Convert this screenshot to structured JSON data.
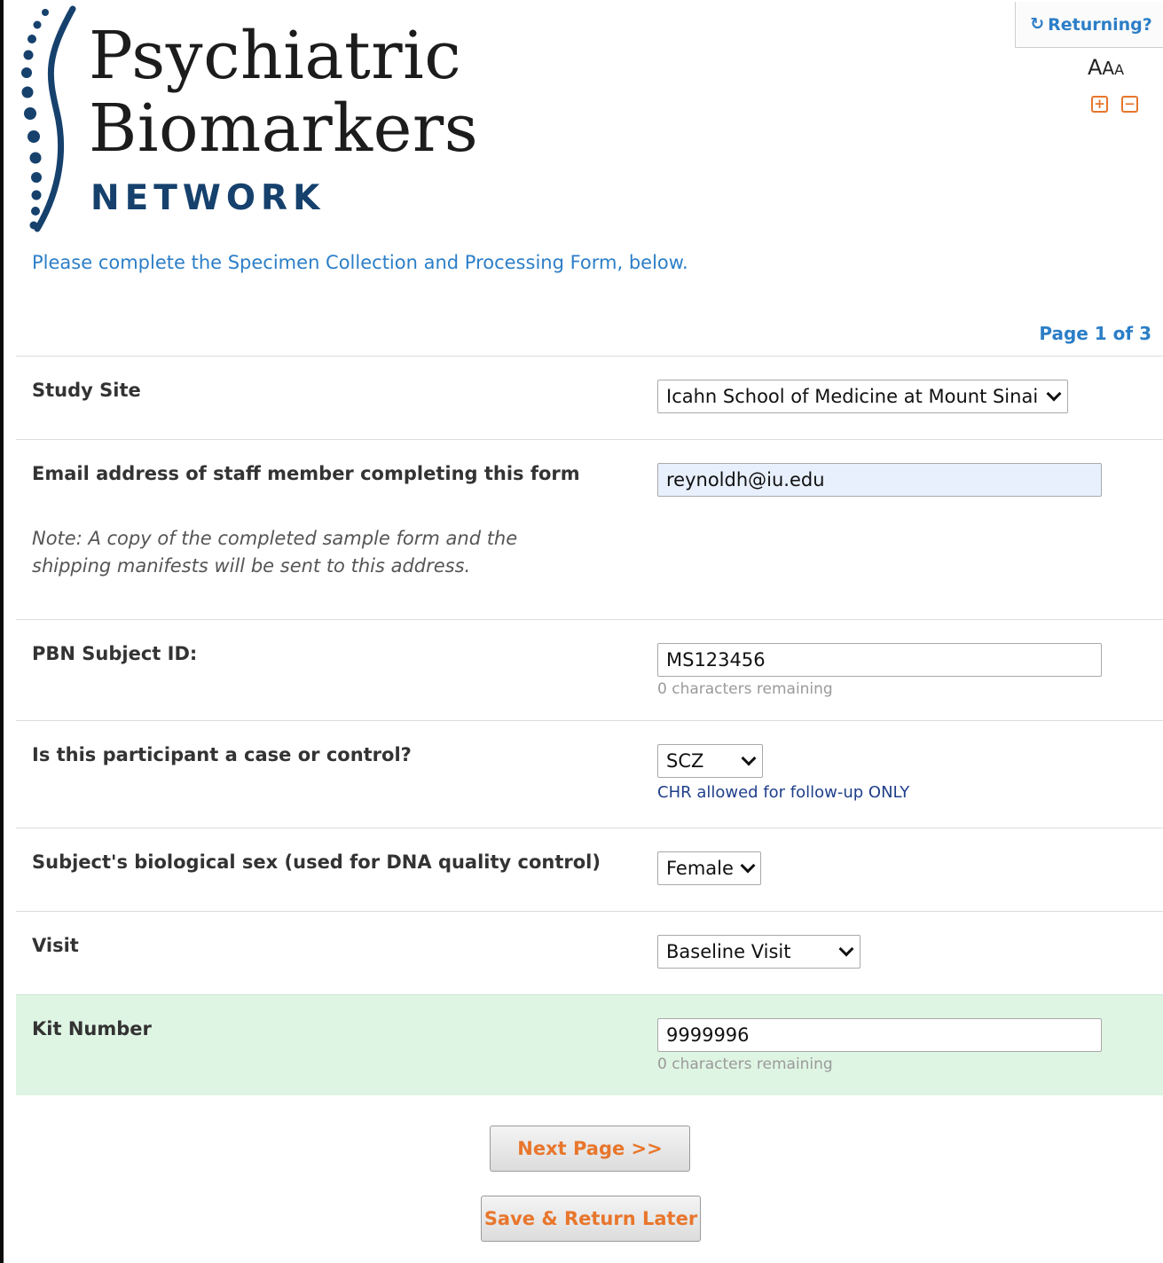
{
  "logo": {
    "line1": "Psychiatric",
    "line2": "Biomarkers",
    "line3": "NETWORK",
    "accent_color": "#16416d"
  },
  "returning": {
    "icon": "refresh-icon",
    "label": "Returning?"
  },
  "font_size_control": {
    "large": "A",
    "medium": "A",
    "small": "A",
    "increase_icon": "plus-square-icon",
    "decrease_icon": "minus-square-icon"
  },
  "intro_text": "Please complete the Specimen Collection and Processing Form, below.",
  "pager": "Page 1 of 3",
  "form": {
    "study_site": {
      "label": "Study Site",
      "selected": "Icahn School of Medicine at Mount Sinai"
    },
    "email": {
      "label": "Email address of staff member completing this form",
      "value": "reynoldh@iu.edu",
      "note": "Note: A copy of the completed sample form and the shipping manifests will be sent to this address."
    },
    "subject_id": {
      "label": "PBN Subject ID:",
      "value": "MS123456",
      "hint": "0 characters remaining"
    },
    "case_control": {
      "label": "Is this participant a case or control?",
      "selected": "SCZ",
      "hint": "CHR allowed for follow-up ONLY"
    },
    "sex": {
      "label": "Subject's biological sex (used for DNA quality control)",
      "selected": "Female"
    },
    "visit": {
      "label": "Visit",
      "selected": "Baseline Visit"
    },
    "kit_number": {
      "label": "Kit Number",
      "value": "9999996",
      "hint": "0 characters remaining"
    }
  },
  "buttons": {
    "next": "Next Page >>",
    "save": "Save & Return Later"
  },
  "colors": {
    "link_blue": "#2c7ec7",
    "button_orange": "#e8762c",
    "highlight_green": "#dff5e3",
    "autofill_blue": "#e8f0fe"
  }
}
